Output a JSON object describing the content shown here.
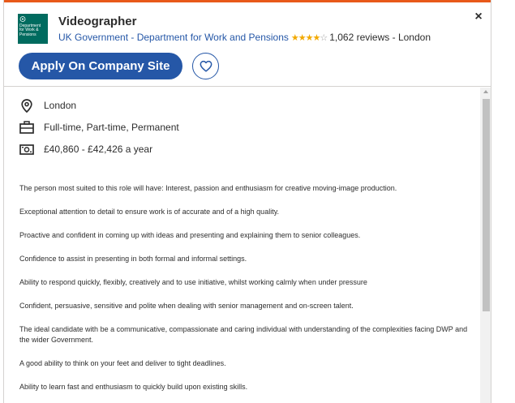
{
  "job": {
    "title": "Videographer",
    "company": "UK Government - Department for Work and Pensions",
    "rating_stars": "★★★★",
    "rating_empty_star": "☆",
    "reviews": "1,062 reviews",
    "separator": " - ",
    "location": "London",
    "logo_text": [
      "Department",
      "for Work &",
      "Pensions"
    ]
  },
  "actions": {
    "apply_label": "Apply On Company Site",
    "close_glyph": "×"
  },
  "meta": {
    "location": "London",
    "job_type": "Full-time, Part-time, Permanent",
    "salary": "£40,860 - £42,426 a year"
  },
  "description": [
    "The person most suited to this role will have: Interest, passion and enthusiasm for creative moving-image production.",
    "Exceptional attention to detail to ensure work is of accurate and of a high quality.",
    "Proactive and confident in coming up with ideas and presenting and explaining them to senior colleagues.",
    "Confidence to assist in presenting in both formal and informal settings.",
    "Ability to respond quickly, flexibly, creatively and to use initiative, whilst working calmly when under pressure",
    "Confident, persuasive, sensitive and polite when dealing with senior management and on-screen talent.",
    "The ideal candidate with be a communicative, compassionate and caring individual with understanding of the complexities facing DWP and the wider Government.",
    "A good ability to think on your feet and deliver to tight deadlines.",
    "Ability to learn fast and enthusiasm to quickly build upon existing skills."
  ],
  "colors": {
    "accent": "#e8591a",
    "brand_blue": "#2557a7",
    "logo_green": "#006b5f",
    "star": "#f2a900"
  }
}
